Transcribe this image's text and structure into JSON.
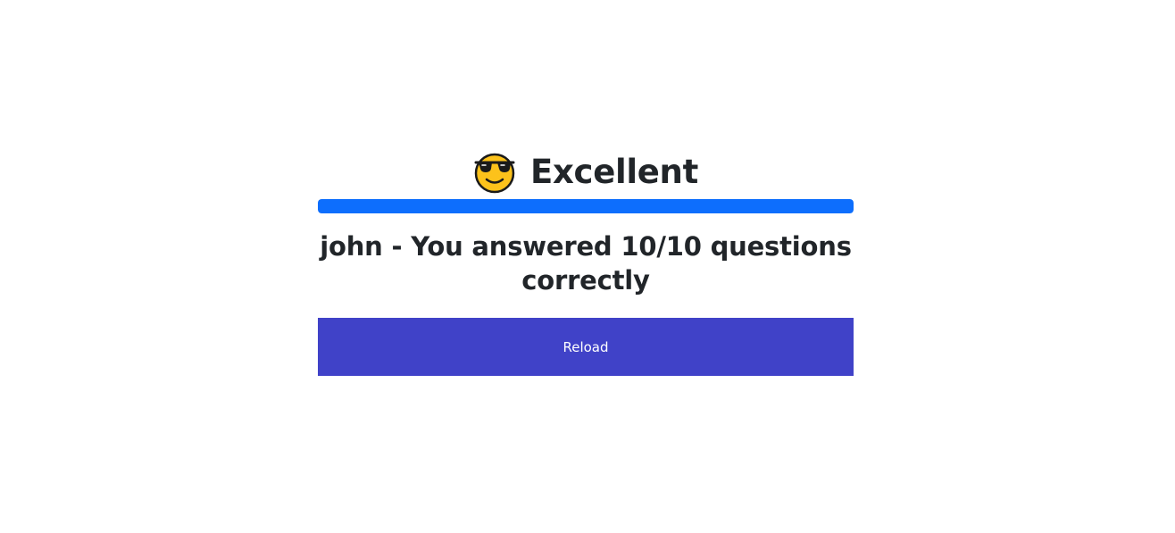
{
  "result": {
    "title": "Excellent",
    "emoji_icon": "smiling-face-with-sunglasses-icon",
    "progress_fraction": 1.0,
    "progress_color": "#0d6efd",
    "score_message": "john - You answered 10/10 questions correctly",
    "reload_label": "Reload",
    "button_color": "#4042c8"
  }
}
